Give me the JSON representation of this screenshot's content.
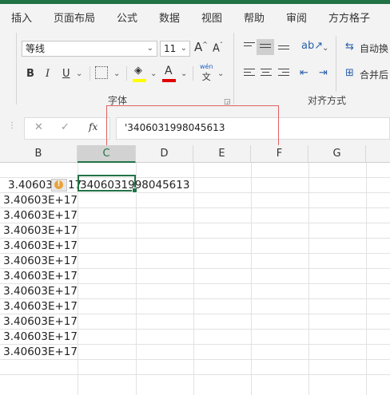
{
  "ribbon_tabs": [
    "插入",
    "页面布局",
    "公式",
    "数据",
    "视图",
    "帮助",
    "审阅",
    "方方格子"
  ],
  "font": {
    "name": "等线",
    "size": "11",
    "bold": "B",
    "italic": "I",
    "underline": "U",
    "wen": "wén",
    "wen_char": "文",
    "increase": "A",
    "decrease": "A"
  },
  "groups": {
    "font_label": "字体",
    "align_label": "对齐方式",
    "wrap_text": "自动换",
    "merge_center": "合并后"
  },
  "formula_bar": {
    "cancel": "✕",
    "enter": "✓",
    "fx": "fx",
    "value": "'3406031998045613"
  },
  "columns": [
    "B",
    "C",
    "D",
    "E",
    "F",
    "G"
  ],
  "selected_column": "C",
  "cells": {
    "b_values": [
      "3.40603",
      "3.40603E+17",
      "3.40603E+17",
      "3.40603E+17",
      "3.40603E+17",
      "3.40603E+17",
      "3.40603E+17",
      "3.40603E+17",
      "3.40603E+17",
      "3.40603E+17",
      "3.40603E+17",
      "3.40603E+17"
    ],
    "b_first_suffix": "17",
    "c_active": "3406031998045613"
  },
  "warning_icon": "!",
  "colors": {
    "accent": "#217346",
    "highlight": "#e06060",
    "warning": "#e8a33d"
  }
}
